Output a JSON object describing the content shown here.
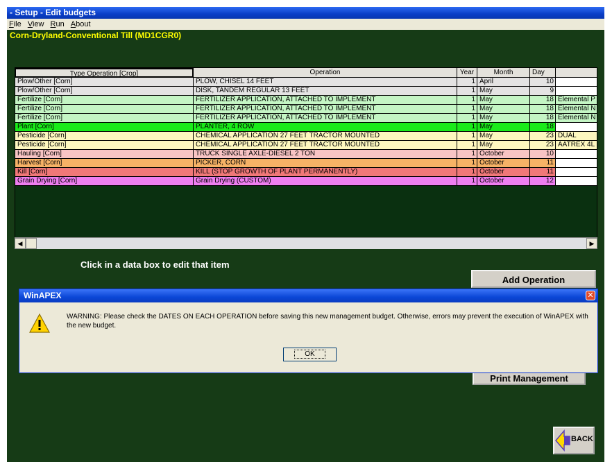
{
  "window": {
    "title": "- Setup - Edit budgets"
  },
  "menu": [
    "File",
    "View",
    "Run",
    "About"
  ],
  "subtitle": "Corn-Dryland-Conventional Till  (MD1CGR0)",
  "table": {
    "headers": [
      "Type Operation [Crop]",
      "Operation",
      "Year",
      "Month",
      "Day"
    ],
    "rows": [
      {
        "type": "Plow/Other [Corn]",
        "op": "PLOW, CHISEL 14 FEET",
        "year": "1",
        "month": "April",
        "day": "10",
        "extra": "",
        "color": "#e4e3e3"
      },
      {
        "type": "Plow/Other [Corn]",
        "op": "DISK, TANDEM  REGULAR 13 FEET",
        "year": "1",
        "month": "May",
        "day": "9",
        "extra": "",
        "color": "#e4e3e3"
      },
      {
        "type": "Fertilize [Corn]",
        "op": "FERTILIZER APPLICATION, ATTACHED TO IMPLEMENT",
        "year": "1",
        "month": "May",
        "day": "18",
        "extra": "Elemental P",
        "color": "#c4f5c4"
      },
      {
        "type": "Fertilize [Corn]",
        "op": "FERTILIZER APPLICATION, ATTACHED TO IMPLEMENT",
        "year": "1",
        "month": "May",
        "day": "18",
        "extra": "Elemental N",
        "color": "#c4f5c4"
      },
      {
        "type": "Fertilize [Corn]",
        "op": "FERTILIZER APPLICATION, ATTACHED TO IMPLEMENT",
        "year": "1",
        "month": "May",
        "day": "18",
        "extra": "Elemental N",
        "color": "#c4f5c4"
      },
      {
        "type": "Plant [Corn]",
        "op": "PLANTER, 4 ROW",
        "year": "1",
        "month": "May",
        "day": "18",
        "extra": "",
        "color": "#1aeb1a"
      },
      {
        "type": "Pesticide [Corn]",
        "op": "CHEMICAL APPLICATION 27 FEET TRACTOR MOUNTED",
        "year": "1",
        "month": "May",
        "day": "23",
        "extra": "DUAL",
        "color": "#fdf7bf"
      },
      {
        "type": "Pesticide [Corn]",
        "op": "CHEMICAL APPLICATION 27 FEET TRACTOR MOUNTED",
        "year": "1",
        "month": "May",
        "day": "23",
        "extra": "AATREX 4L",
        "color": "#fdf7bf"
      },
      {
        "type": "Hauling [Corn]",
        "op": "TRUCK SINGLE AXLE-DIESEL 2 TON",
        "year": "1",
        "month": "October",
        "day": "10",
        "extra": "",
        "color": "#f8c4c4"
      },
      {
        "type": "Harvest [Corn]",
        "op": "PICKER, CORN",
        "year": "1",
        "month": "October",
        "day": "11",
        "extra": "",
        "color": "#f6b266"
      },
      {
        "type": "Kill [Corn]",
        "op": "KILL (STOP GROWTH OF PLANT PERMANENTLY)",
        "year": "1",
        "month": "October",
        "day": "11",
        "extra": "",
        "color": "#f07878"
      },
      {
        "type": "Grain Drying [Corn]",
        "op": "Grain Drying (CUSTOM)",
        "year": "1",
        "month": "October",
        "day": "12",
        "extra": "",
        "color": "#ee7ef0"
      }
    ]
  },
  "hint": "Click in a data box to edit that item",
  "buttons": {
    "add_operation": "Add  Operation",
    "print_management": "Print Management",
    "back": "BACK"
  },
  "dialog": {
    "title": "WinAPEX",
    "message": "WARNING: Please check the DATES ON EACH OPERATION before saving this new management budget. Otherwise, errors may prevent the execution of WinAPEX with the new budget.",
    "ok": "OK"
  },
  "colors": {
    "background": "#163b16",
    "subtitle": "#ffff00",
    "titlebar": "#0a3ec7"
  }
}
